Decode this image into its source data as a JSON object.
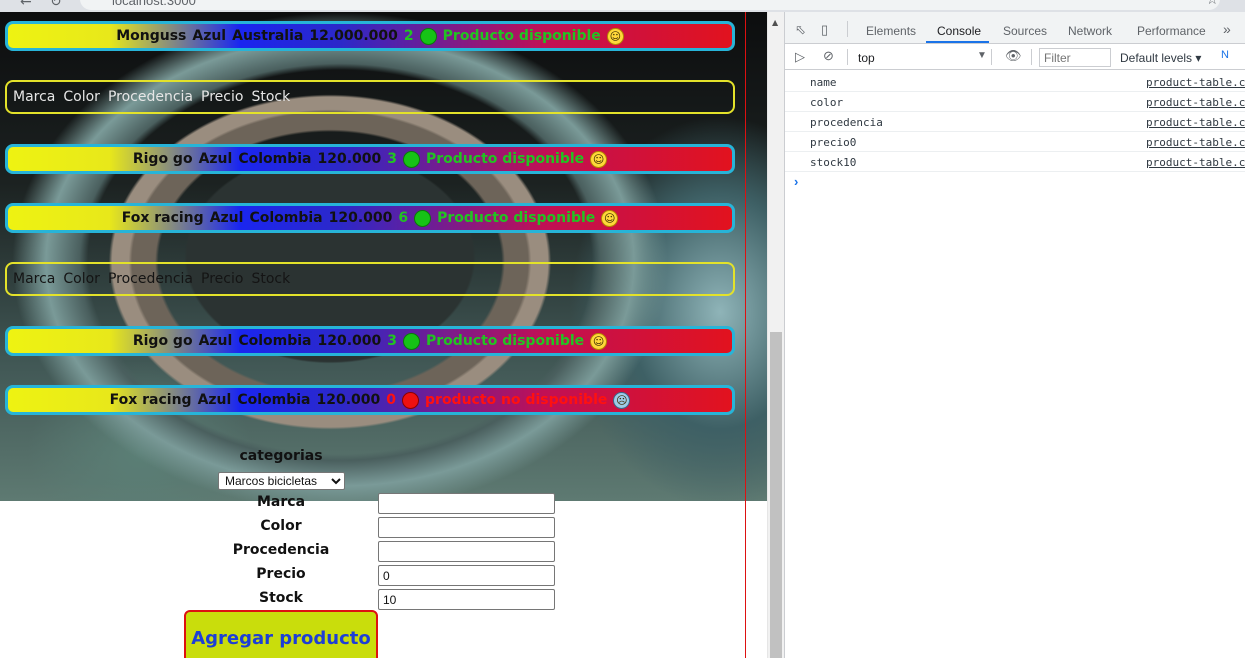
{
  "browser": {
    "url": "localhost:3000"
  },
  "products": [
    {
      "marca": "Monguss",
      "color": "Azul",
      "procedencia": "Australia",
      "precio": "12.000.000",
      "stock": "2",
      "status": "Producto disponible",
      "available": true
    },
    {
      "header": [
        "Marca",
        "Color",
        "Procedencia",
        "Precio",
        "Stock"
      ]
    },
    {
      "marca": "Rigo go",
      "color": "Azul",
      "procedencia": "Colombia",
      "precio": "120.000",
      "stock": "3",
      "status": "Producto disponible",
      "available": true
    },
    {
      "marca": "Fox racing",
      "color": "Azul",
      "procedencia": "Colombia",
      "precio": "120.000",
      "stock": "6",
      "status": "Producto disponible",
      "available": true
    },
    {
      "header": [
        "Marca",
        "Color",
        "Procedencia",
        "Precio",
        "Stock"
      ]
    },
    {
      "marca": "Rigo go",
      "color": "Azul",
      "procedencia": "Colombia",
      "precio": "120.000",
      "stock": "3",
      "status": "Producto disponible",
      "available": true
    },
    {
      "marca": "Fox racing",
      "color": "Azul",
      "procedencia": "Colombia",
      "precio": "120.000",
      "stock": "0",
      "status": "producto no disponible",
      "available": false
    }
  ],
  "form": {
    "categorias_label": "categorias",
    "categoria_selected": "Marcos bicicletas",
    "fields": [
      {
        "label": "Marca",
        "value": ""
      },
      {
        "label": "Color",
        "value": ""
      },
      {
        "label": "Procedencia",
        "value": ""
      },
      {
        "label": "Precio",
        "value": "0"
      },
      {
        "label": "Stock",
        "value": "10"
      }
    ],
    "submit_label": "Agregar producto"
  },
  "devtools": {
    "tabs": [
      "Elements",
      "Console",
      "Sources",
      "Network",
      "Performance"
    ],
    "active_tab": "Console",
    "more": "»",
    "context": "top",
    "filter_placeholder": "Filter",
    "levels": "Default levels ▾",
    "issues": "N",
    "logs": [
      {
        "message": "name",
        "source": "product-table.c"
      },
      {
        "message": "color",
        "source": "product-table.c"
      },
      {
        "message": "procedencia",
        "source": "product-table.c"
      },
      {
        "message": "precio0",
        "source": "product-table.c"
      },
      {
        "message": "stock10",
        "source": "product-table.c"
      }
    ],
    "prompt": "›"
  },
  "colors": {
    "bar_border": "#27b4d8",
    "header_border": "#e3e22a",
    "available": "#22c322",
    "unavailable": "#ff1010",
    "button_bg": "#c9dd0c",
    "button_text": "#1d3fd6",
    "button_border": "#dd1111"
  },
  "icons": {
    "available": "green-circle-icon",
    "unavailable": "red-circle-icon",
    "happy": "smiley-icon",
    "sad": "anxious-face-icon"
  }
}
